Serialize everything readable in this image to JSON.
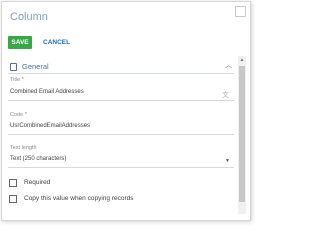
{
  "dialog": {
    "title": "Column",
    "save_label": "SAVE",
    "cancel_label": "CANCEL"
  },
  "section": {
    "title": "General",
    "icon": "document-icon",
    "expanded": true
  },
  "fields": {
    "title": {
      "label": "Title",
      "required_mark": "*",
      "value": "Combined Email Addresses"
    },
    "code": {
      "label": "Code",
      "required_mark": "*",
      "value": "UsrCombinedEmailAddresses"
    },
    "text_length": {
      "label": "Text length",
      "value": "Text (250 characters)"
    }
  },
  "checkboxes": {
    "required": {
      "label": "Required",
      "checked": false
    },
    "copy_value": {
      "label": "Copy this value when copying records",
      "checked": false
    }
  },
  "colors": {
    "save_button": "#3aa64a",
    "link": "#1f6fb5",
    "title": "#7fa0c7",
    "required": "#e05a2b"
  }
}
